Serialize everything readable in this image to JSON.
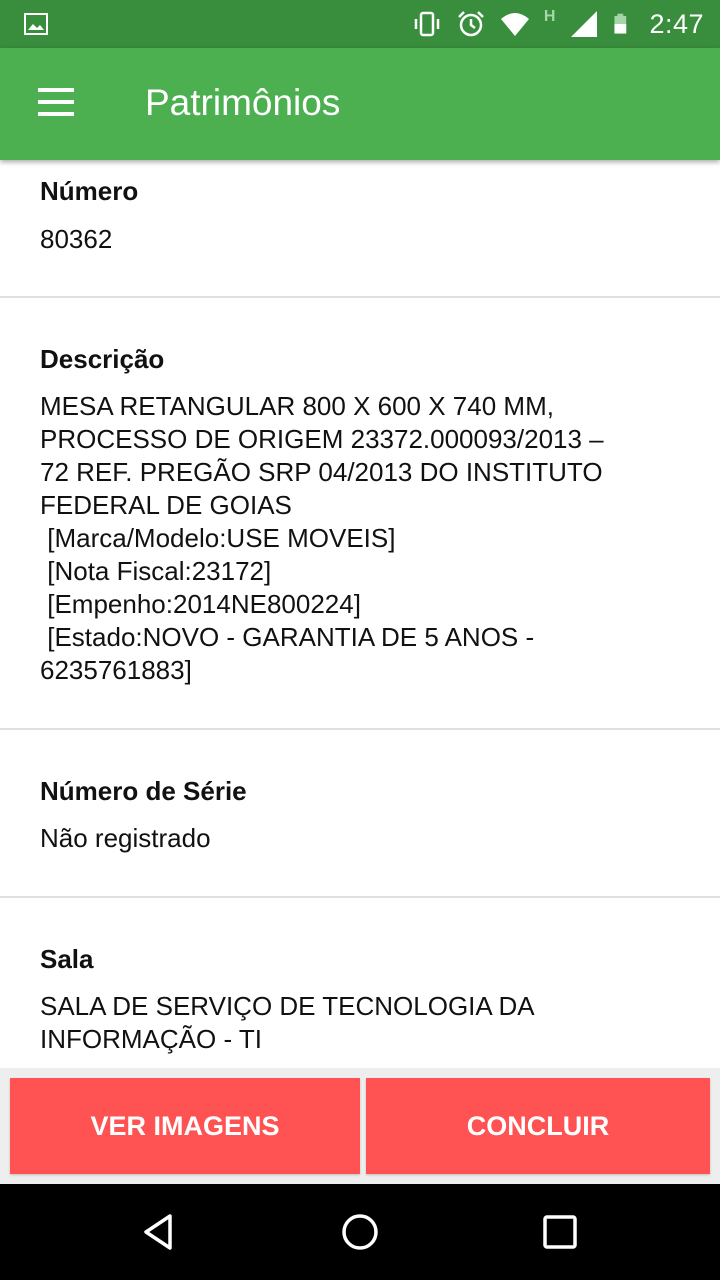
{
  "status_bar": {
    "time": "2:47",
    "network_label": "H",
    "icons": [
      "image-icon",
      "vibrate-icon",
      "alarm-icon",
      "wifi-icon",
      "signal-icon",
      "battery-icon"
    ]
  },
  "app_bar": {
    "title": "Patrimônios",
    "menu_icon": "hamburger-menu-icon"
  },
  "fields": {
    "numero": {
      "label": "Número",
      "value": "80362"
    },
    "descricao": {
      "label": "Descrição",
      "value": "MESA RETANGULAR 800 X 600 X 740 MM,\nPROCESSO DE ORIGEM 23372.000093/2013 –\n72 REF. PREGÃO SRP 04/2013 DO INSTITUTO\nFEDERAL DE GOIAS\n [Marca/Modelo:USE MOVEIS]\n [Nota Fiscal:23172]\n [Empenho:2014NE800224]\n [Estado:NOVO - GARANTIA DE 5 ANOS -\n6235761883]"
    },
    "serie": {
      "label": "Número de Série",
      "value": "Não registrado"
    },
    "sala": {
      "label": "Sala",
      "value": "SALA DE SERVIÇO DE TECNOLOGIA DA\nINFORMAÇÃO - TI"
    }
  },
  "buttons": {
    "ver_imagens": "VER IMAGENS",
    "concluir": "CONCLUIR"
  },
  "colors": {
    "status_bar": "#388e3c",
    "app_bar": "#4caf50",
    "button": "#ff5252"
  },
  "nav_bar": {
    "icons": [
      "back-icon",
      "home-icon",
      "recents-icon"
    ]
  }
}
